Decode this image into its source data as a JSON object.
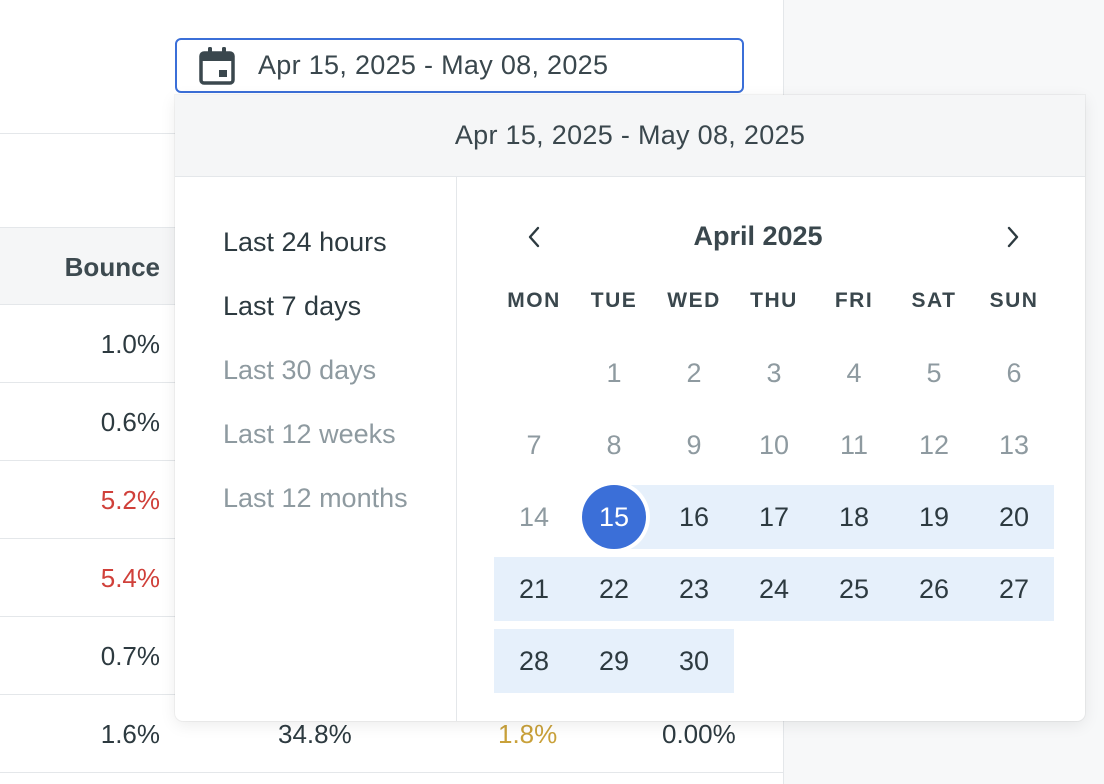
{
  "table": {
    "header_bounce": "Bounce",
    "rows": [
      {
        "bounce": "1.0%",
        "bounce_color": "#2d3a40"
      },
      {
        "bounce": "0.6%",
        "bounce_color": "#2d3a40"
      },
      {
        "bounce": "5.2%",
        "bounce_color": "#d0403a"
      },
      {
        "bounce": "5.4%",
        "bounce_color": "#d0403a"
      },
      {
        "bounce": "0.7%",
        "bounce_color": "#2d3a40"
      },
      {
        "bounce": "1.6%",
        "bounce_color": "#2d3a40",
        "c2": "34.8%",
        "c3": "1.8%",
        "c3_color": "#c9a13a",
        "c4": "0.00%"
      }
    ]
  },
  "date_input": {
    "icon": "calendar-icon",
    "value": "Apr 15, 2025 - May 08, 2025"
  },
  "popover": {
    "header": "Apr 15, 2025 - May 08, 2025",
    "presets": [
      {
        "label": "Last 24 hours",
        "enabled": true
      },
      {
        "label": "Last 7 days",
        "enabled": true
      },
      {
        "label": "Last 30 days",
        "enabled": false
      },
      {
        "label": "Last 12 weeks",
        "enabled": false
      },
      {
        "label": "Last 12 months",
        "enabled": false
      }
    ],
    "calendar": {
      "month": "April 2025",
      "prev_icon": "chevron-left-icon",
      "next_icon": "chevron-right-icon",
      "weekdays": [
        "MON",
        "TUE",
        "WED",
        "THU",
        "FRI",
        "SAT",
        "SUN"
      ],
      "weeks": [
        [
          "",
          "1",
          "2",
          "3",
          "4",
          "5",
          "6"
        ],
        [
          "7",
          "8",
          "9",
          "10",
          "11",
          "12",
          "13"
        ],
        [
          "14",
          "15",
          "16",
          "17",
          "18",
          "19",
          "20"
        ],
        [
          "21",
          "22",
          "23",
          "24",
          "25",
          "26",
          "27"
        ],
        [
          "28",
          "29",
          "30",
          "",
          "",
          "",
          ""
        ]
      ],
      "range_start_day": 15,
      "range_end_day": 30,
      "accent_color": "#3b6fd8",
      "range_color": "#e6f0fb"
    }
  }
}
